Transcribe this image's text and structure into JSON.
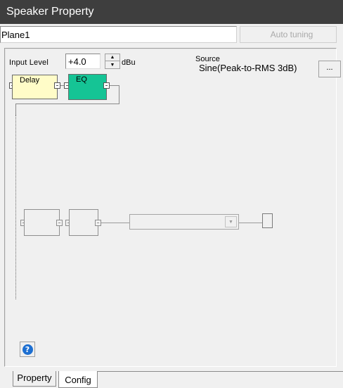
{
  "window": {
    "title": "Speaker Property"
  },
  "header": {
    "name_value": "Plane1",
    "auto_tuning_label": "Auto tuning"
  },
  "input": {
    "label": "Input Level",
    "value": "+4.0",
    "unit": "dBu"
  },
  "source": {
    "label": "Source",
    "value": "Sine(Peak-to-RMS 3dB)",
    "browse_label": "..."
  },
  "blocks": {
    "delay_label": "Delay",
    "eq_label": "EQ"
  },
  "help": {
    "label": "?"
  },
  "tabs": [
    {
      "label": "Property"
    },
    {
      "label": "Config"
    }
  ]
}
